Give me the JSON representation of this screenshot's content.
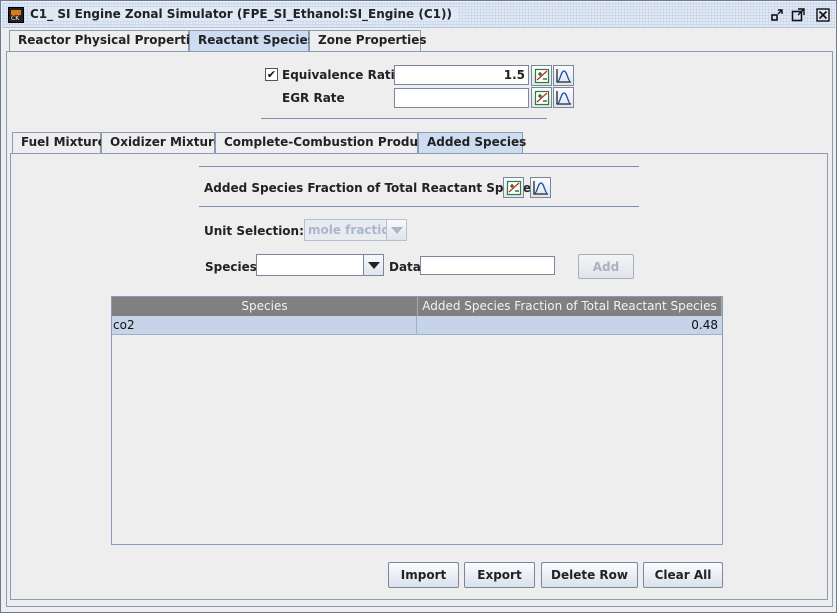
{
  "window": {
    "title": "C1_ SI Engine Zonal Simulator  (FPE_SI_Ethanol:SI_Engine (C1))",
    "app_icon_text": "CK"
  },
  "top_tabs": [
    {
      "label": "Reactor Physical Properties",
      "active": false
    },
    {
      "label": "Reactant Species",
      "active": true
    },
    {
      "label": "Zone Properties",
      "active": false
    }
  ],
  "equivalence_ratio": {
    "label": "Equivalence Ratio",
    "checked": true,
    "check_mark": "✔",
    "value": "1.5"
  },
  "egr_rate": {
    "label": "EGR Rate",
    "value": ""
  },
  "sub_tabs": [
    {
      "label": "Fuel Mixture",
      "active": false
    },
    {
      "label": "Oxidizer Mixture",
      "active": false
    },
    {
      "label": "Complete-Combustion Products",
      "active": false
    },
    {
      "label": "Added Species",
      "active": true
    }
  ],
  "added_species": {
    "heading": "Added Species Fraction of Total Reactant Species",
    "unit_label": "Unit Selection:",
    "unit_value": "mole fraction",
    "species_label": "Species",
    "species_value": "",
    "data_label": "Data",
    "data_value": "",
    "add_button": "Add"
  },
  "table": {
    "columns": [
      "Species",
      "Added Species Fraction of Total Reactant Species"
    ],
    "rows": [
      {
        "species": "co2",
        "fraction": "0.48"
      }
    ]
  },
  "buttons": {
    "import": "Import",
    "export": "Export",
    "delete_row": "Delete Row",
    "clear_all": "Clear All"
  },
  "icons": {
    "edit_profile": "profile-editor-icon",
    "plot_profile": "profile-plot-icon"
  }
}
